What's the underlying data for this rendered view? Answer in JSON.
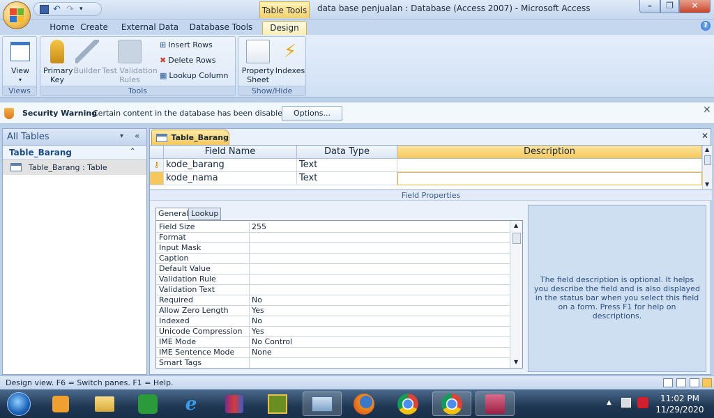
{
  "window": {
    "context_tab": "Table Tools",
    "title": "data base penjualan : Database (Access 2007) - Microsoft Access",
    "controls": [
      "minimize-icon",
      "restore-icon",
      "close-icon"
    ]
  },
  "ribbon": {
    "tabs": [
      "Home",
      "Create",
      "External Data",
      "Database Tools",
      "Design"
    ],
    "active_tab": "Design",
    "groups": {
      "views": {
        "label": "Views",
        "view_button": "View"
      },
      "tools": {
        "label": "Tools",
        "primary_key": "Primary Key",
        "builder": "Builder",
        "test_validation_rules": "Test Validation Rules",
        "insert_rows": "Insert Rows",
        "delete_rows": "Delete Rows",
        "lookup_column": "Lookup Column"
      },
      "showhide": {
        "label": "Show/Hide",
        "property_sheet": "Property Sheet",
        "indexes": "Indexes"
      }
    }
  },
  "security": {
    "title": "Security Warning",
    "message": "Certain content in the database has been disabled",
    "options_button": "Options..."
  },
  "nav": {
    "header": "All Tables",
    "group": "Table_Barang",
    "item": "Table_Barang : Table"
  },
  "document": {
    "tab": "Table_Barang",
    "columns": {
      "field_name": "Field Name",
      "data_type": "Data Type",
      "description": "Description"
    },
    "rows": [
      {
        "field": "kode_barang",
        "type": "Text",
        "description": ""
      },
      {
        "field": "kode_nama",
        "type": "Text",
        "description": ""
      }
    ],
    "field_properties_label": "Field Properties",
    "prop_tabs": [
      "General",
      "Lookup"
    ],
    "properties": [
      {
        "name": "Field Size",
        "value": "255"
      },
      {
        "name": "Format",
        "value": ""
      },
      {
        "name": "Input Mask",
        "value": ""
      },
      {
        "name": "Caption",
        "value": ""
      },
      {
        "name": "Default Value",
        "value": ""
      },
      {
        "name": "Validation Rule",
        "value": ""
      },
      {
        "name": "Validation Text",
        "value": ""
      },
      {
        "name": "Required",
        "value": "No"
      },
      {
        "name": "Allow Zero Length",
        "value": "Yes"
      },
      {
        "name": "Indexed",
        "value": "No"
      },
      {
        "name": "Unicode Compression",
        "value": "Yes"
      },
      {
        "name": "IME Mode",
        "value": "No Control"
      },
      {
        "name": "IME Sentence Mode",
        "value": "None"
      },
      {
        "name": "Smart Tags",
        "value": ""
      }
    ],
    "help_text": "The field description is optional.  It helps you describe the field and is also displayed in the status bar when you select this field on a form.  Press F1 for help on descriptions."
  },
  "status": {
    "text": "Design view.  F6 = Switch panes.  F1 = Help."
  },
  "taskbar": {
    "apps": [
      "start-orb",
      "media-player",
      "file-explorer",
      "hao123",
      "internet-explorer",
      "winrar",
      "naruto-app",
      "keyboard-app",
      "firefox",
      "chrome",
      "chrome-user",
      "access"
    ],
    "time": "11:02 PM",
    "date": "11/29/2020"
  },
  "colors": {
    "accent": "#f6c85b",
    "ribbon": "#d0e0f4",
    "taskbar": "#1f3752"
  }
}
